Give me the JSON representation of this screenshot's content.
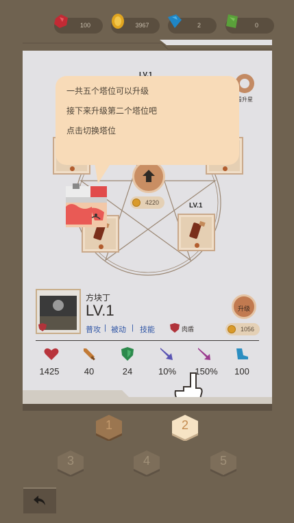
{
  "resources": [
    {
      "icon": "red-gem-icon",
      "value": "100",
      "color": "#c22a34"
    },
    {
      "icon": "gold-coin-icon",
      "value": "3967",
      "color": "#e0a520"
    },
    {
      "icon": "blue-gem-icon",
      "value": "2",
      "color": "#1f86c6"
    },
    {
      "icon": "green-card-icon",
      "value": "0",
      "color": "#5aa03a"
    }
  ],
  "tooltip": {
    "lines": [
      "一共五个塔位可以升级",
      "接下来升级第二个塔位吧",
      "点击切换塔位"
    ]
  },
  "board": {
    "top_lv_label": "LV.1",
    "right_lv_label": "LV.1",
    "partial_label": "看升星",
    "center_cost": "4220"
  },
  "hero": {
    "name": "方块丁",
    "level": "LV.1",
    "skills": [
      "普攻",
      "被动",
      "技能"
    ],
    "separators": [
      "|",
      "|"
    ],
    "armor_type": "肉盾",
    "upgrade_label": "升级",
    "upgrade_cost": "1056"
  },
  "stats": [
    {
      "icon": "heart-icon",
      "value": "1425",
      "color": "#b8343c"
    },
    {
      "icon": "sword-icon",
      "value": "40",
      "color": "#c27a35"
    },
    {
      "icon": "shield-icon",
      "value": "24",
      "color": "#2c8a4c"
    },
    {
      "icon": "crit-arrow-icon",
      "value": "10%",
      "color": "#5a55b3"
    },
    {
      "icon": "crit-damage-icon",
      "value": "150%",
      "color": "#9b3b8f"
    },
    {
      "icon": "boot-icon",
      "value": "100",
      "color": "#2b8ec1"
    }
  ],
  "tower_slots": {
    "numbers": [
      "1",
      "2",
      "3",
      "4",
      "5"
    ],
    "selected": "2"
  }
}
